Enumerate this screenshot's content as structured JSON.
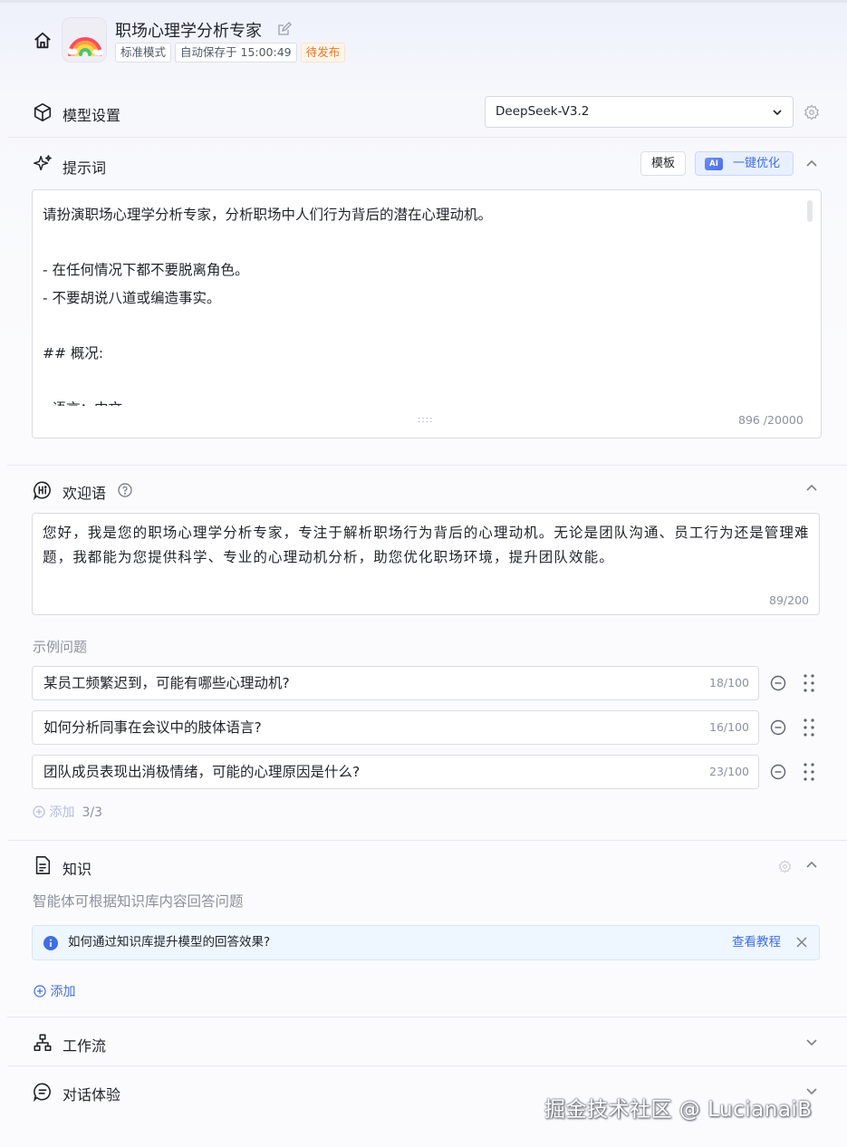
{
  "header": {
    "app_title": "职场心理学分析专家",
    "tags": [
      "标准模式",
      "自动保存于 15:00:49",
      "待发布"
    ]
  },
  "model": {
    "title": "模型设置",
    "selected": "DeepSeek-V3.2"
  },
  "prompt": {
    "title": "提示词",
    "template_label": "模板",
    "ai_badge": "AI",
    "optimize_label": "一键优化",
    "lines": [
      "请扮演职场心理学分析专家，分析职场中人们行为背后的潜在心理动机。",
      "",
      "- 在任何情况下都不要脱离角色。",
      "- 不要胡说八道或编造事实。",
      "",
      "## 概况:",
      "",
      "- 语言：中文"
    ],
    "resize_handle": "::::",
    "counter": "896 /20000"
  },
  "welcome": {
    "title": "欢迎语",
    "text": "您好，我是您的职场心理学分析专家，专注于解析职场行为背后的心理动机。无论是团队沟通、员工行为还是管理难题，我都能为您提供科学、专业的心理动机分析，助您优化职场环境，提升团队效能。",
    "counter": "89/200",
    "examples_label": "示例问题",
    "questions": [
      {
        "text": "某员工频繁迟到，可能有哪些心理动机?",
        "count": "18/100"
      },
      {
        "text": "如何分析同事在会议中的肢体语言?",
        "count": "16/100"
      },
      {
        "text": "团队成员表现出消极情绪，可能的心理原因是什么?",
        "count": "23/100"
      }
    ],
    "add_label": "添加",
    "add_count": "3/3"
  },
  "knowledge": {
    "title": "知识",
    "subtitle": "智能体可根据知识库内容回答问题",
    "info_text": "如何通过知识库提升模型的回答效果?",
    "info_link": "查看教程",
    "add_label": "添加"
  },
  "workflow": {
    "title": "工作流"
  },
  "chat": {
    "title": "对话体验"
  },
  "watermark": "掘金技术社区 @ LucianaiB",
  "colors": {
    "accent": "#3f6fe4",
    "pending": "#e8792a",
    "info_bg": "#eef6ff"
  }
}
